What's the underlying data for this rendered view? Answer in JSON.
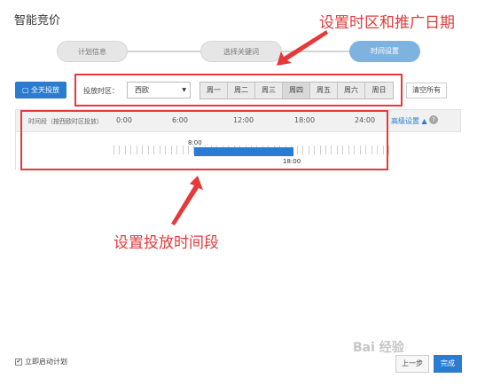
{
  "header": {
    "title": "智能竞价"
  },
  "steps": [
    {
      "label": "计划信息"
    },
    {
      "label": "选择关键词"
    },
    {
      "label": "时间设置"
    }
  ],
  "annotations": {
    "top": "设置时区和推广日期",
    "middle": "设置投放时间段"
  },
  "controls": {
    "allday_label": "全天投放",
    "timezone_label": "投放时区：",
    "timezone_value": "西欧",
    "days": [
      "周一",
      "周二",
      "周三",
      "周四",
      "周五",
      "周六",
      "周日"
    ],
    "active_day_index": 3,
    "clear_label": "清空所有"
  },
  "timeline": {
    "caption": "时间段（按西欧时区投放）",
    "tick_labels": [
      "0:00",
      "6:00",
      "12:00",
      "18:00",
      "24:00"
    ],
    "advanced_label": "高级设置",
    "range_start": "8:00",
    "range_end": "18:00"
  },
  "footer": {
    "autostart_label": "立即启动计划",
    "prev_label": "上一步",
    "done_label": "完成"
  },
  "colors": {
    "accent": "#2b7bd0",
    "annotation": "#e5393a",
    "active_step": "#7fb3df"
  }
}
